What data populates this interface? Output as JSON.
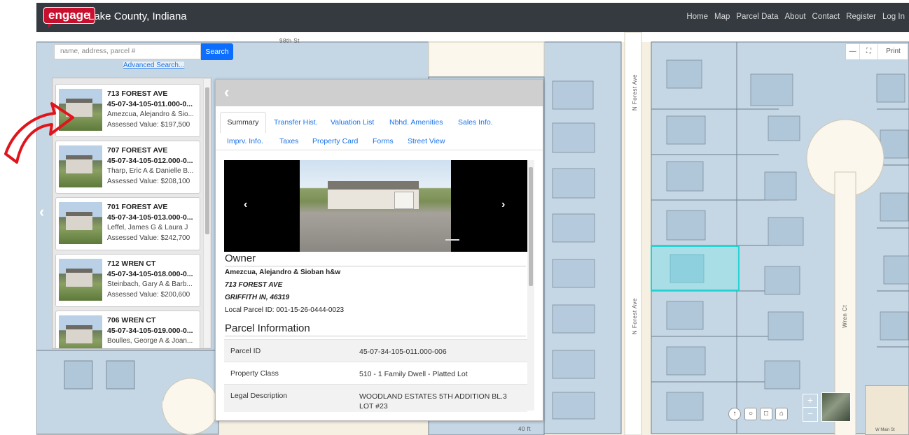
{
  "header": {
    "logo": "engage",
    "title": "Lake County, Indiana",
    "nav": [
      "Home",
      "Map",
      "Parcel Data",
      "About",
      "Contact",
      "Register",
      "Log In"
    ]
  },
  "search": {
    "placeholder": "name, address, parcel #",
    "button": "Search",
    "advanced": "Advanced Search..."
  },
  "map_tools": {
    "print": "Print"
  },
  "map_labels": {
    "street_98th": "98th St",
    "forest_ave_1": "N Forest Ave",
    "forest_ave_2": "N Forest Ave",
    "wren_ct": "Wren Ct",
    "scale": "40 ft",
    "minimap_label": "W Main St"
  },
  "results": [
    {
      "address": "713 FOREST AVE",
      "parcel": "45-07-34-105-011.000-0...",
      "owner": "Amezcua, Alejandro & Sio...",
      "value": "Assessed Value: $197,500"
    },
    {
      "address": "707 FOREST AVE",
      "parcel": "45-07-34-105-012.000-0...",
      "owner": "Tharp, Eric A & Danielle B...",
      "value": "Assessed Value: $208,100"
    },
    {
      "address": "701 FOREST AVE",
      "parcel": "45-07-34-105-013.000-0...",
      "owner": "Leffel, James G & Laura J",
      "value": "Assessed Value: $242,700"
    },
    {
      "address": "712 WREN CT",
      "parcel": "45-07-34-105-018.000-0...",
      "owner": "Steinbach, Gary A & Barb...",
      "value": "Assessed Value: $200,600"
    },
    {
      "address": "706 WREN CT",
      "parcel": "45-07-34-105-019.000-0...",
      "owner": "Boulles, George A & Joan...",
      "value": ""
    }
  ],
  "detail": {
    "tabs_row1": [
      "Summary",
      "Transfer Hist.",
      "Valuation List",
      "Nbhd. Amenities",
      "Sales Info."
    ],
    "tabs_row2": [
      "Imprv. Info.",
      "Taxes",
      "Property Card",
      "Forms",
      "Street View"
    ],
    "owner_heading": "Owner",
    "owner_name": "Amezcua, Alejandro & Sioban h&w",
    "owner_street": "713 FOREST AVE",
    "owner_city": "GRIFFITH IN, 46319",
    "local_parcel": "Local Parcel ID: 001-15-26-0444-0023",
    "parcel_heading": "Parcel Information",
    "rows": [
      {
        "key": "Parcel ID",
        "value": "45-07-34-105-011.000-006"
      },
      {
        "key": "Property Class",
        "value": "510 - 1 Family Dwell - Platted Lot"
      },
      {
        "key": "Legal Description",
        "value": "WOODLAND ESTATES 5TH ADDITION BL.3 LOT #23"
      }
    ]
  },
  "colors": {
    "header_bg": "#343a40",
    "accent": "#0d6efd",
    "selection": "#20d3d3",
    "parcel_fill": "#b7cde0"
  }
}
